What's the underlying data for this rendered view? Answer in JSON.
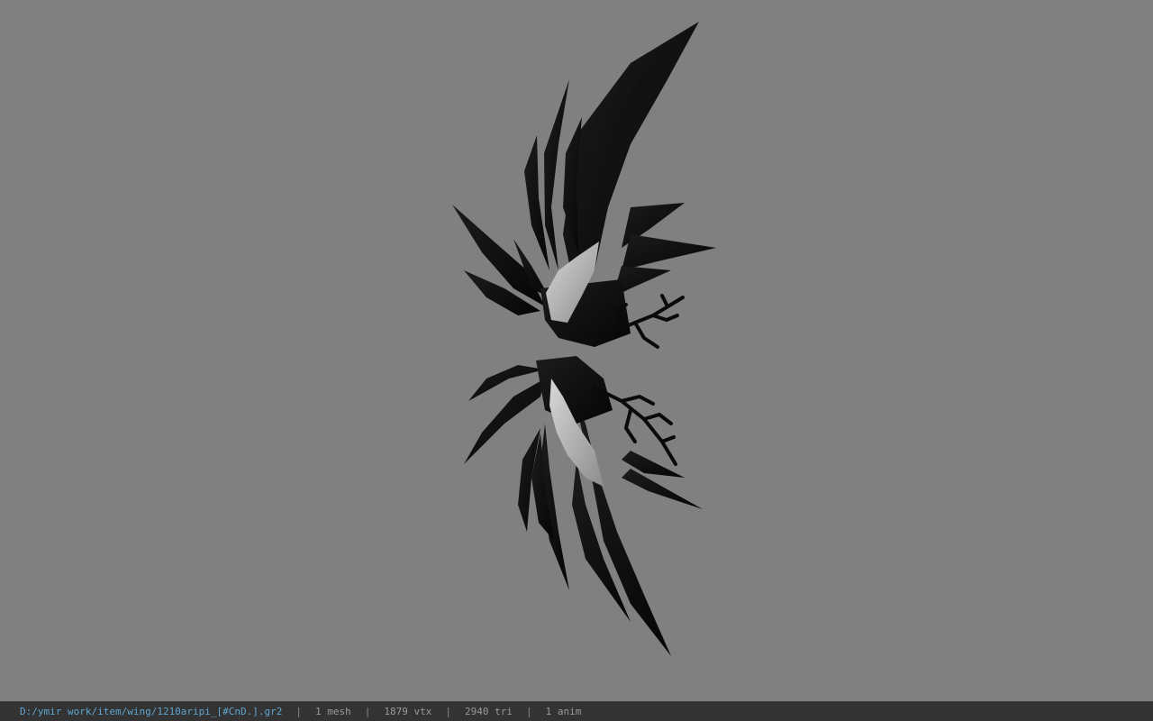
{
  "viewer": {
    "background_color": "#808080",
    "model_name": "wing-model"
  },
  "status_bar": {
    "file_path": "D:/ymir work/item/wing/1210aripi_[#CnD.].gr2",
    "separator": "|",
    "mesh_count": "1 mesh",
    "vertex_count": "1879 vtx",
    "triangle_count": "2940 tri",
    "anim_count": "1 anim",
    "path_color": "#5fa6d2",
    "text_color": "#9a9a9a"
  }
}
